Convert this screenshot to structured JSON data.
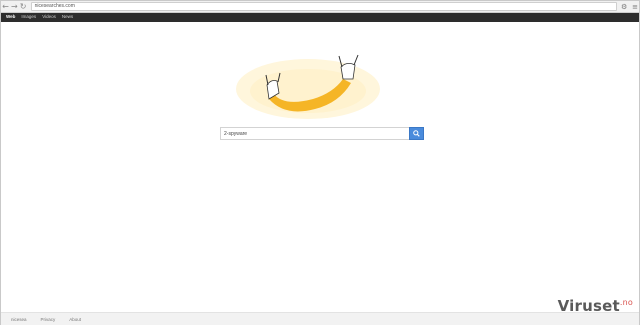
{
  "browser": {
    "url": "nicesearches.com",
    "back_icon": "back-arrow-icon",
    "forward_icon": "forward-arrow-icon",
    "reload_icon": "reload-icon",
    "home_icon": "home-icon"
  },
  "site_nav": {
    "items": [
      {
        "label": "Web",
        "active": true
      },
      {
        "label": "Images",
        "active": false
      },
      {
        "label": "Videos",
        "active": false
      },
      {
        "label": "News",
        "active": false
      }
    ]
  },
  "logo": {
    "icon": "rock-hands-arm-logo",
    "colors": {
      "arm": "#f5b526",
      "glow": "#fff3cf"
    }
  },
  "search": {
    "value": "2-spyware",
    "button_icon": "search-icon",
    "button_color": "#4a8bdc"
  },
  "footer": {
    "links": [
      "nicesea",
      "Privacy",
      "About"
    ]
  },
  "watermark": {
    "brand": "Viruset",
    "tld": ".no"
  }
}
